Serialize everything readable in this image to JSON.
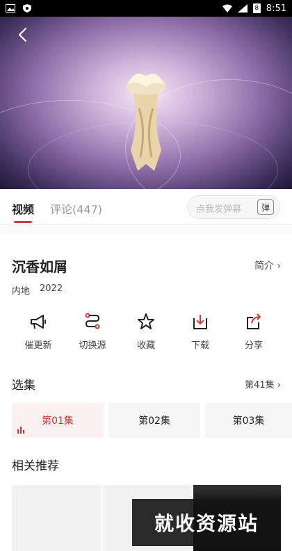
{
  "status_bar": {
    "time": "8:51",
    "battery": "8"
  },
  "video": {
    "back_icon": "chevron-left-icon"
  },
  "tabs": [
    {
      "label": "视频",
      "active": true
    },
    {
      "label": "评论(447)",
      "active": false
    }
  ],
  "danmaku": {
    "placeholder": "点我发弹幕",
    "button_label": "弹"
  },
  "show": {
    "title": "沉香如屑",
    "intro_label": "简介 ›",
    "region": "内地",
    "year": "2022"
  },
  "actions": [
    {
      "label": "催更新",
      "icon": "megaphone-icon"
    },
    {
      "label": "切换源",
      "icon": "switch-source-icon"
    },
    {
      "label": "收藏",
      "icon": "star-icon"
    },
    {
      "label": "下载",
      "icon": "download-icon"
    },
    {
      "label": "分享",
      "icon": "share-icon"
    }
  ],
  "episodes": {
    "title": "选集",
    "count_label": "第41集 ›",
    "items": [
      {
        "label": "第01集",
        "active": true
      },
      {
        "label": "第02集",
        "active": false
      },
      {
        "label": "第03集",
        "active": false
      }
    ]
  },
  "related": {
    "title": "相关推荐"
  },
  "watermark": {
    "text": "就收资源站"
  },
  "colors": {
    "accent": "#d23c3c"
  }
}
